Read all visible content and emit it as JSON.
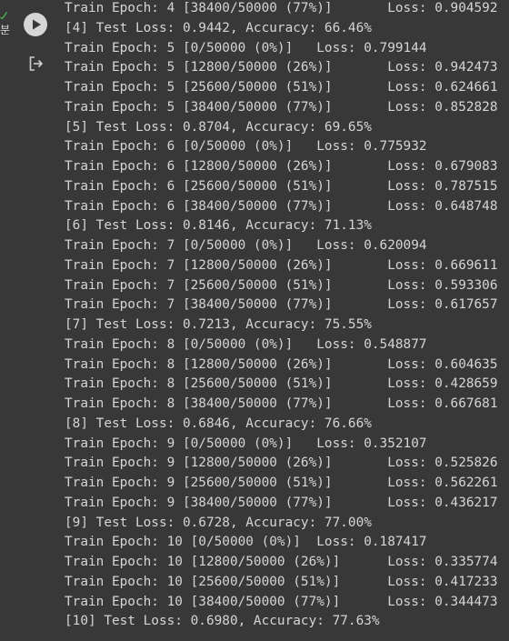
{
  "cell": {
    "exec_time_fragment": "분",
    "run_button_icon": "play-icon",
    "output_action_icon": "output-exit-icon",
    "status_icon": "check-icon",
    "status_color": "#4caf50"
  },
  "colors": {
    "background": "#383838",
    "text": "#d5d5d5",
    "run_button": "#d6d6d6",
    "icon": "#cfcfcf"
  },
  "output_lines": [
    "Train Epoch: 4 [38400/50000 (77%)]       Loss: 0.904592",
    "[4] Test Loss: 0.9442, Accuracy: 66.46%",
    "Train Epoch: 5 [0/50000 (0%)]   Loss: 0.799144",
    "Train Epoch: 5 [12800/50000 (26%)]       Loss: 0.942473",
    "Train Epoch: 5 [25600/50000 (51%)]       Loss: 0.624661",
    "Train Epoch: 5 [38400/50000 (77%)]       Loss: 0.852828",
    "[5] Test Loss: 0.8704, Accuracy: 69.65%",
    "Train Epoch: 6 [0/50000 (0%)]   Loss: 0.775932",
    "Train Epoch: 6 [12800/50000 (26%)]       Loss: 0.679083",
    "Train Epoch: 6 [25600/50000 (51%)]       Loss: 0.787515",
    "Train Epoch: 6 [38400/50000 (77%)]       Loss: 0.648748",
    "[6] Test Loss: 0.8146, Accuracy: 71.13%",
    "Train Epoch: 7 [0/50000 (0%)]   Loss: 0.620094",
    "Train Epoch: 7 [12800/50000 (26%)]       Loss: 0.669611",
    "Train Epoch: 7 [25600/50000 (51%)]       Loss: 0.593306",
    "Train Epoch: 7 [38400/50000 (77%)]       Loss: 0.617657",
    "[7] Test Loss: 0.7213, Accuracy: 75.55%",
    "Train Epoch: 8 [0/50000 (0%)]   Loss: 0.548877",
    "Train Epoch: 8 [12800/50000 (26%)]       Loss: 0.604635",
    "Train Epoch: 8 [25600/50000 (51%)]       Loss: 0.428659",
    "Train Epoch: 8 [38400/50000 (77%)]       Loss: 0.667681",
    "[8] Test Loss: 0.6846, Accuracy: 76.66%",
    "Train Epoch: 9 [0/50000 (0%)]   Loss: 0.352107",
    "Train Epoch: 9 [12800/50000 (26%)]       Loss: 0.525826",
    "Train Epoch: 9 [25600/50000 (51%)]       Loss: 0.562261",
    "Train Epoch: 9 [38400/50000 (77%)]       Loss: 0.436217",
    "[9] Test Loss: 0.6728, Accuracy: 77.00%",
    "Train Epoch: 10 [0/50000 (0%)]  Loss: 0.187417",
    "Train Epoch: 10 [12800/50000 (26%)]      Loss: 0.335774",
    "Train Epoch: 10 [25600/50000 (51%)]      Loss: 0.417233",
    "Train Epoch: 10 [38400/50000 (77%)]      Loss: 0.344473",
    "[10] Test Loss: 0.6980, Accuracy: 77.63%"
  ]
}
